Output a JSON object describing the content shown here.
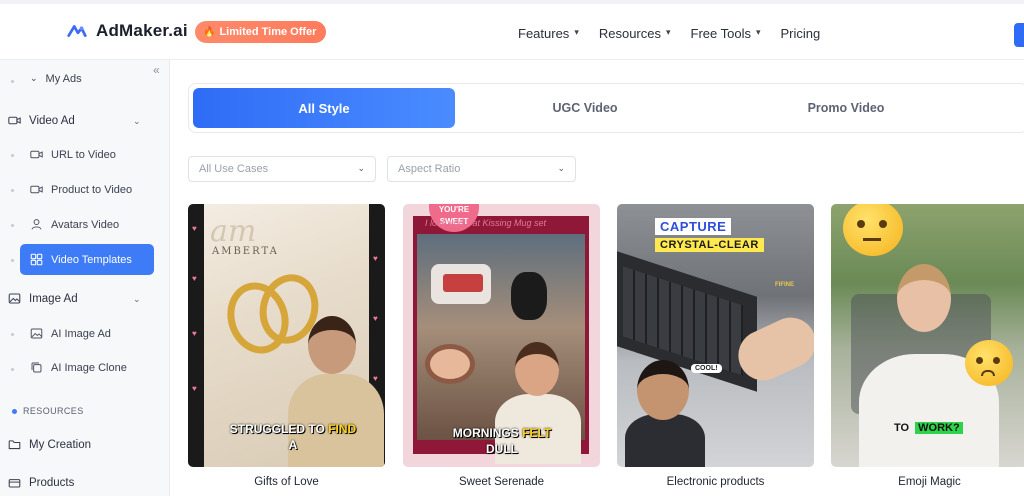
{
  "header": {
    "logo_text": "AdMaker.ai",
    "offer_label": "Limited Time Offer",
    "nav": [
      {
        "label": "Features",
        "has_dropdown": true
      },
      {
        "label": "Resources",
        "has_dropdown": true
      },
      {
        "label": "Free Tools",
        "has_dropdown": true
      },
      {
        "label": "Pricing",
        "has_dropdown": false
      }
    ],
    "accent_color": "#2f6cf6"
  },
  "sidebar": {
    "collapse_glyph": "«",
    "items": [
      {
        "label": "My Ads",
        "level": "sub",
        "icon": "chevron-icon"
      },
      {
        "label": "Video Ad",
        "level": "main",
        "icon": "video-camera-icon",
        "expanded": true
      },
      {
        "label": "URL to Video",
        "level": "sub",
        "icon": "video-camera-icon"
      },
      {
        "label": "Product to Video",
        "level": "sub",
        "icon": "video-camera-icon"
      },
      {
        "label": "Avatars Video",
        "level": "sub",
        "icon": "user-icon"
      },
      {
        "label": "Video Templates",
        "level": "sub",
        "icon": "template-icon",
        "active": true
      },
      {
        "label": "Image Ad",
        "level": "main",
        "icon": "image-icon",
        "expanded": true
      },
      {
        "label": "AI Image Ad",
        "level": "sub",
        "icon": "image-icon"
      },
      {
        "label": "AI Image Clone",
        "level": "sub",
        "icon": "copy-icon"
      }
    ],
    "section_label": "RESOURCES",
    "resources": [
      {
        "label": "My Creation",
        "icon": "folder-icon"
      },
      {
        "label": "Products",
        "icon": "box-icon"
      }
    ]
  },
  "main": {
    "tabs": [
      {
        "label": "All Style",
        "active": true
      },
      {
        "label": "UGC Video",
        "active": false
      },
      {
        "label": "Promo Video",
        "active": false
      }
    ],
    "filters": [
      {
        "placeholder": "All Use Cases"
      },
      {
        "placeholder": "Aspect Ratio"
      }
    ],
    "templates": [
      {
        "title": "Gifts of Love",
        "brand_text": "am",
        "brand_sub": "AMBERTA",
        "caption_white": "STRUGGLED TO ",
        "caption_yellow": "FIND",
        "caption_line2": "A"
      },
      {
        "title": "Sweet Serenade",
        "badge_text": "YOU'RE SWEET",
        "handwritten": "I love you Cat Kissing Mug set",
        "caption_white": "MORNINGS ",
        "caption_yellow": "FELT",
        "caption_line2": "DULL"
      },
      {
        "title": "Electronic products",
        "headline_1": "CAPTURE",
        "headline_2": "CRYSTAL-CLEAR",
        "sticker": "COOL!",
        "brand_mark": "FIFINE"
      },
      {
        "title": "Emoji Magic",
        "caption_plain": "TO ",
        "caption_highlight": "WORK?"
      }
    ]
  }
}
